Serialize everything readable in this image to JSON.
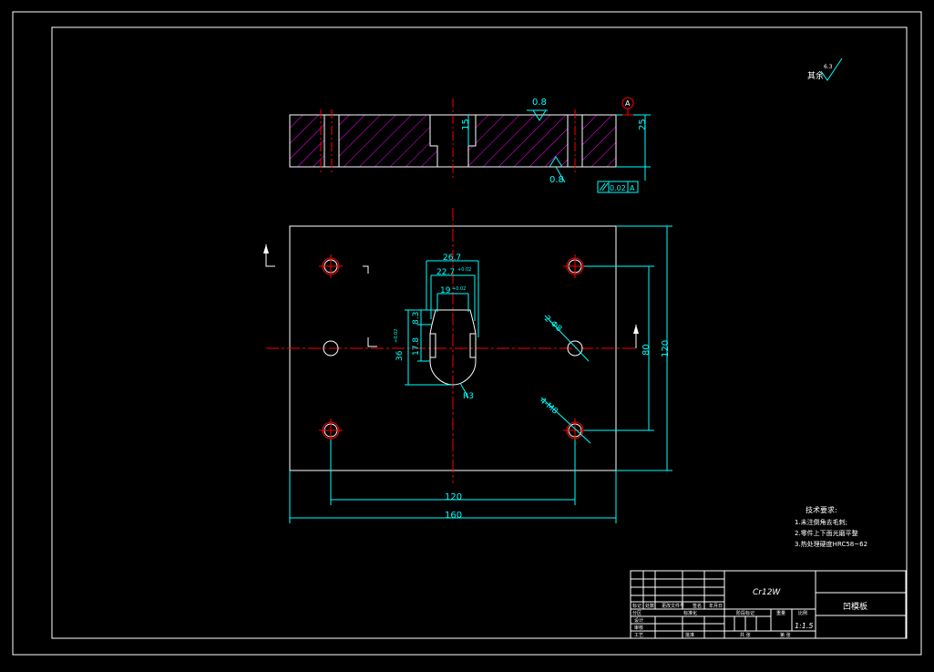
{
  "colors": {
    "background": "#000000",
    "outline": "#ffffff",
    "dimension": "#00ffff",
    "center_line": "#ff0000",
    "hatch": "#ff00ff"
  },
  "roughness": {
    "top_surface": "0.8",
    "bottom_surface": "0.8",
    "other": "其余",
    "other_value": "6.3"
  },
  "datum": "A",
  "section_view": {
    "height_dim": "25",
    "slot_dim": "15",
    "parallelism_tol": "0.02",
    "parallelism_datum": "A"
  },
  "plan_view": {
    "dim_26_7": "26.7",
    "dim_22_7": "22.7",
    "dim_22_7_tol": "+0.02",
    "dim_19": "19",
    "dim_19_tol": "+0.02",
    "dim_8_3": "8.3",
    "dim_17_8": "17.8",
    "dim_36": "36",
    "dim_36_tol": "+0.02",
    "dim_r3": "R3",
    "dim_2_phi8": "2-Φ8",
    "dim_4_m8": "4-M8",
    "dim_80": "80",
    "dim_120_v": "120",
    "dim_120_h": "120",
    "dim_160": "160"
  },
  "tech_requirements": {
    "title": "技术要求:",
    "items": [
      "1.未注倒角去毛刺;",
      "2.零件上下面光磨平整",
      "3.热处理硬度HRC58~62"
    ]
  },
  "title_block": {
    "material": "Cr12W",
    "part_name": "凹模板",
    "scale": "1:1.5",
    "header_labels": [
      "标记",
      "处数",
      "分区",
      "更改文件号",
      "签名",
      "年月日"
    ],
    "row_labels": [
      "设计",
      "审核",
      "工艺"
    ],
    "std": "标准化",
    "approve": "批准",
    "stage_label": "阶段标记",
    "weight_label": "重量",
    "scale_label": "比例",
    "sheets_total": "共 张",
    "sheet_n": "第 张"
  }
}
